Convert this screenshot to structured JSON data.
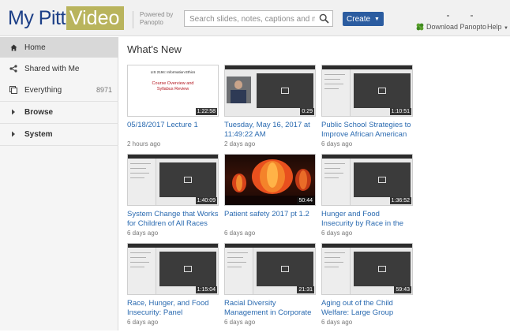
{
  "header": {
    "logo_left": "My Pitt",
    "logo_right": "Video",
    "powered_line1": "Powered by",
    "powered_line2": "Panopto",
    "search_placeholder": "Search slides, notes, captions and more",
    "create_label": "Create",
    "download_label": "Download Panopto",
    "help_label": "Help"
  },
  "sidebar": {
    "items": [
      {
        "label": "Home",
        "icon": "home-icon",
        "active": true
      },
      {
        "label": "Shared with Me",
        "icon": "share-icon"
      },
      {
        "label": "Everything",
        "icon": "everything-icon",
        "count": "8971"
      },
      {
        "label": "Browse",
        "icon": "chevron-right-icon"
      },
      {
        "label": "System",
        "icon": "chevron-right-icon"
      }
    ]
  },
  "main": {
    "title": "What's New",
    "tiles": [
      {
        "title": "05/18/2017 Lecture 1",
        "date": "2 hours ago",
        "duration": "1:22:58",
        "thumb": "slide"
      },
      {
        "title": "Tuesday, May 16, 2017 at 11:49:22 AM",
        "date": "2 days ago",
        "duration": "0:29",
        "thumb": "ui-person"
      },
      {
        "title": "Public School Strategies to Improve African American",
        "date": "6 days ago",
        "duration": "1:10:51",
        "thumb": "ui"
      },
      {
        "title": "System Change that Works for Children of All Races",
        "date": "6 days ago",
        "duration": "1:40:09",
        "thumb": "ui"
      },
      {
        "title": "Patient safety 2017 pt 1.2",
        "date": "6 days ago",
        "duration": "50:44",
        "thumb": "photo"
      },
      {
        "title": "Hunger and Food Insecurity by Race in the",
        "date": "6 days ago",
        "duration": "1:36:52",
        "thumb": "ui"
      },
      {
        "title": "Race, Hunger, and Food Insecurity: Panel",
        "date": "6 days ago",
        "duration": "1:15:04",
        "thumb": "ui"
      },
      {
        "title": "Racial Diversity Management in Corporate",
        "date": "6 days ago",
        "duration": "21:31",
        "thumb": "ui"
      },
      {
        "title": "Aging out of the Child Welfare: Large Group",
        "date": "6 days ago",
        "duration": "59:43",
        "thumb": "ui"
      }
    ],
    "slide_thumb": {
      "line1": "LIS 2194: Information Ethics",
      "line2": "Course Overview and",
      "line3": "Syllabus Review"
    }
  },
  "colors": {
    "logo_blue": "#1c3f87",
    "logo_gold": "#b9b45d",
    "create_blue": "#2b5ca0",
    "link_blue": "#2a6ab0"
  }
}
